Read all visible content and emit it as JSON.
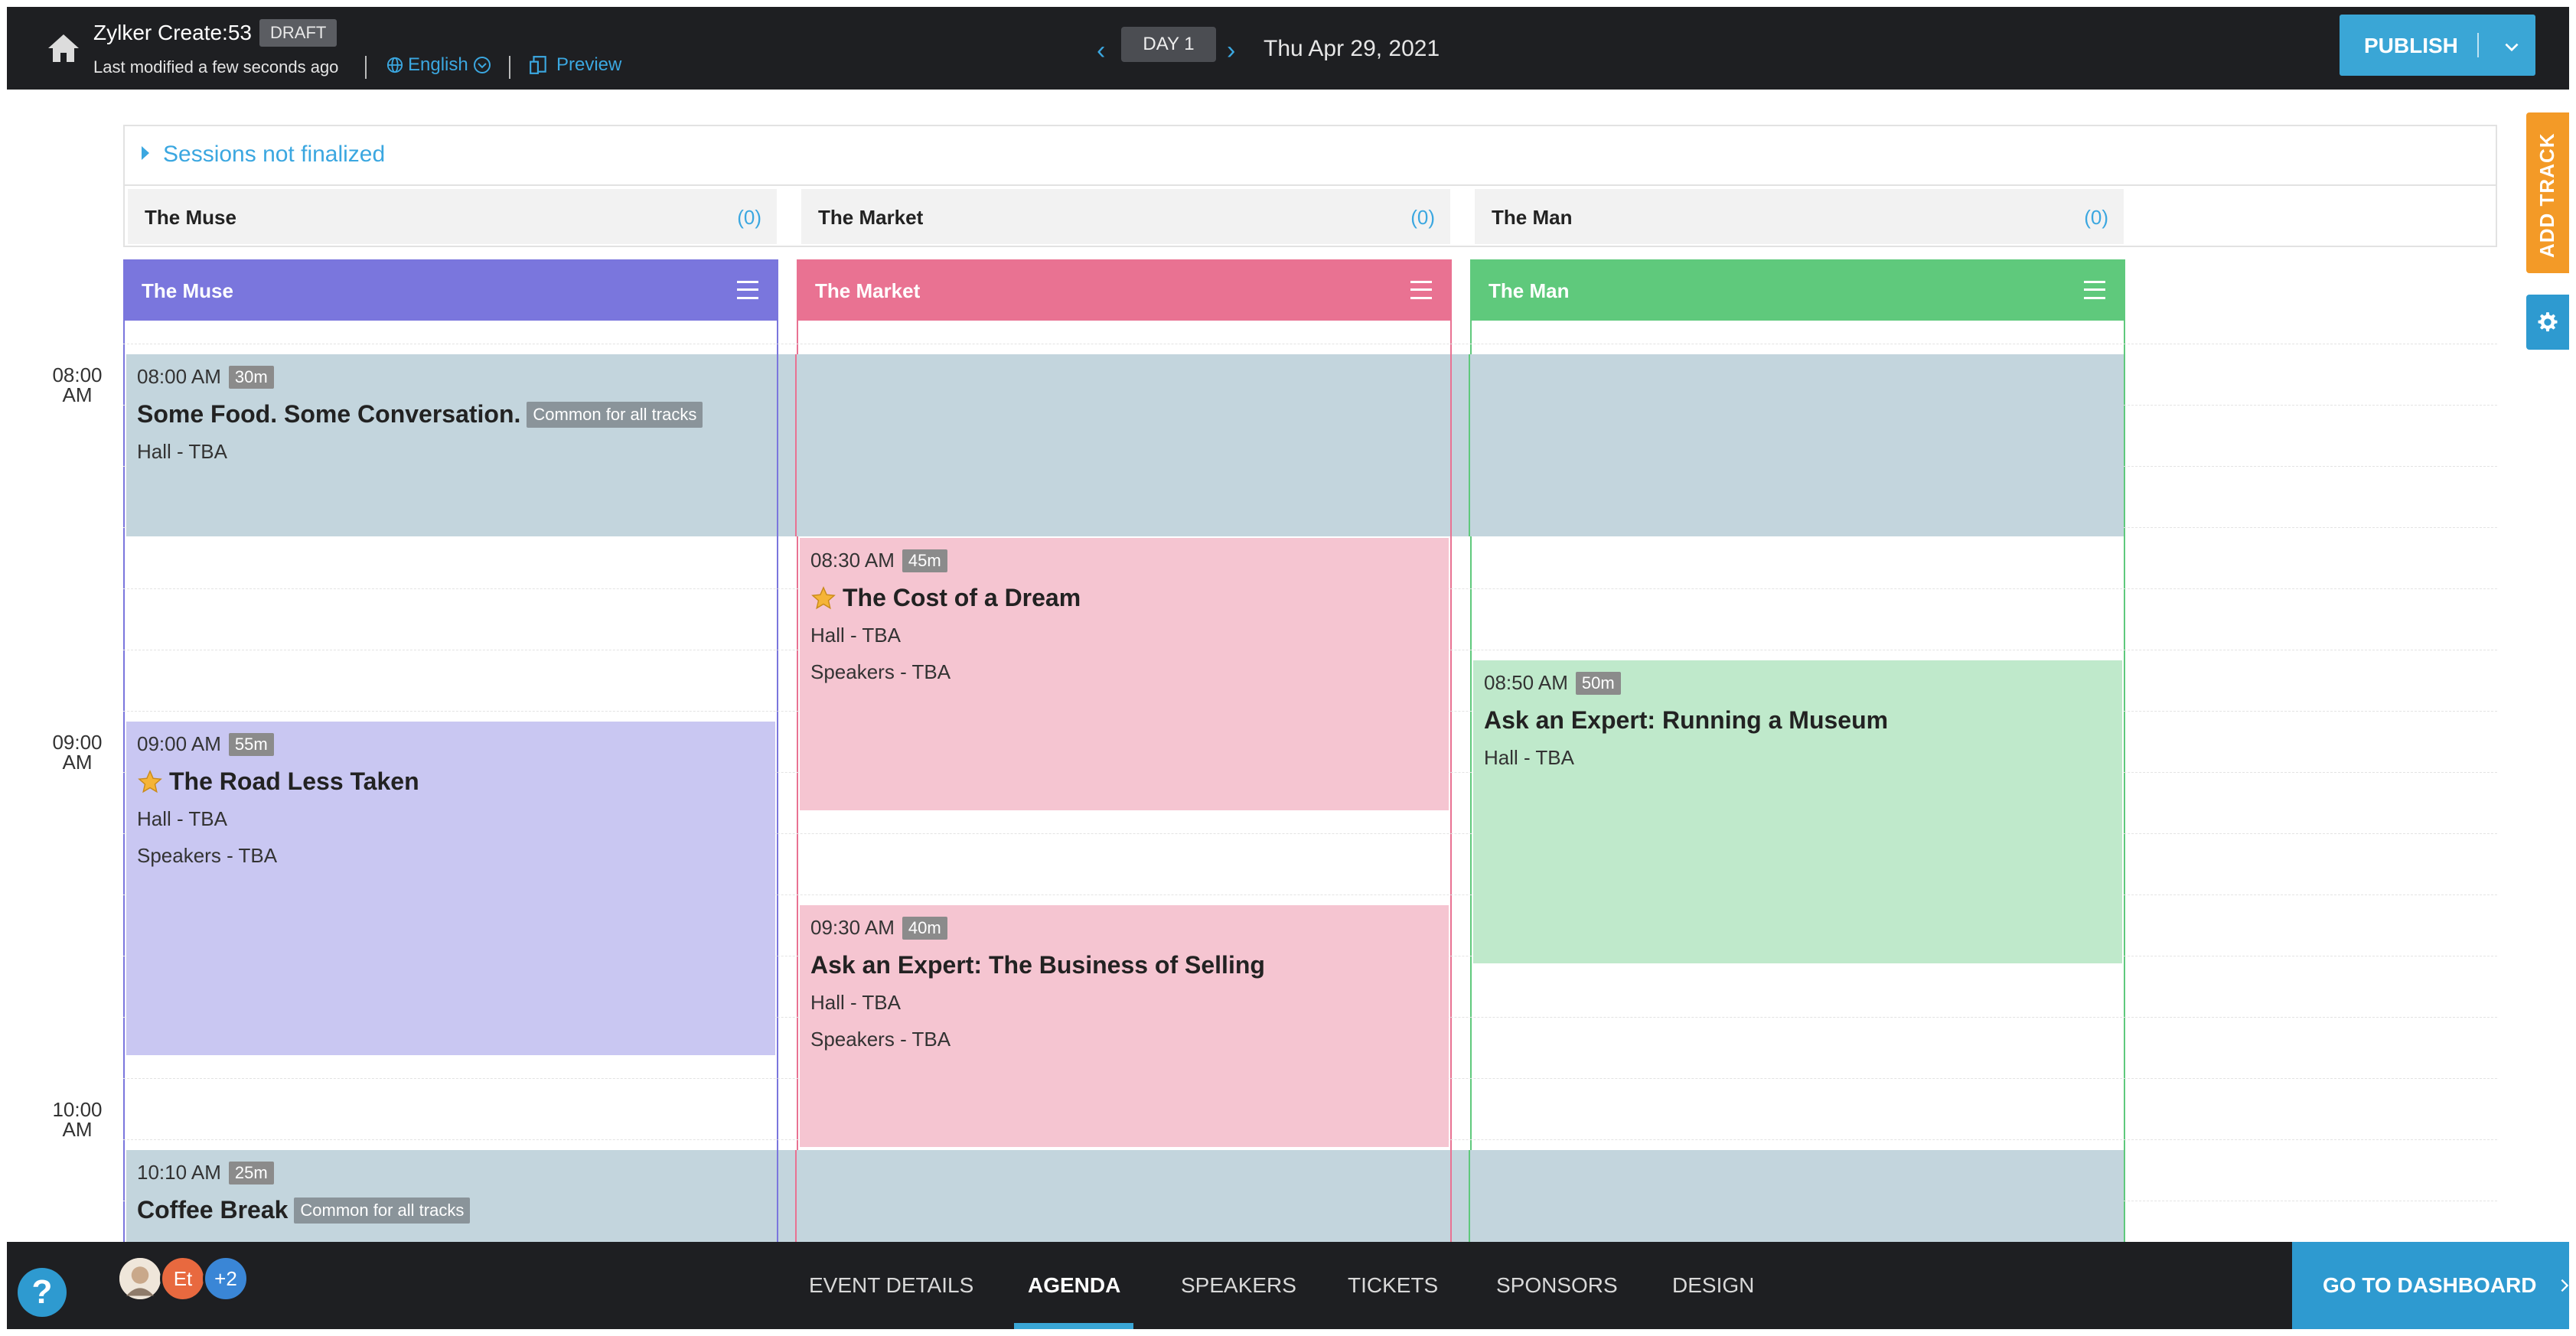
{
  "header": {
    "app_title": "Zylker Create:53",
    "status_badge": "DRAFT",
    "modified_text": "Last modified a few seconds ago",
    "language": "English",
    "preview_label": "Preview",
    "day_label": "DAY 1",
    "date": "Thu Apr 29, 2021",
    "publish_label": "PUBLISH"
  },
  "unfinalized": {
    "label": "Sessions not finalized",
    "tracks": [
      {
        "name": "The Muse",
        "count": "(0)"
      },
      {
        "name": "The Market",
        "count": "(0)"
      },
      {
        "name": "The Man",
        "count": "(0)"
      }
    ]
  },
  "side": {
    "add_track_label": "ADD TRACK"
  },
  "times": [
    {
      "hour": "08:00",
      "period": "AM"
    },
    {
      "hour": "09:00",
      "period": "AM"
    },
    {
      "hour": "10:00",
      "period": "AM"
    }
  ],
  "tracks": [
    {
      "name": "The Muse",
      "color": "#7a76dd"
    },
    {
      "name": "The Market",
      "color": "#e97292"
    },
    {
      "name": "The Man",
      "color": "#5fc97c"
    }
  ],
  "sessions": {
    "food": {
      "time": "08:00 AM",
      "duration": "30m",
      "title": "Some Food. Some Conversation.",
      "tag": "Common for all tracks",
      "hall": "Hall - TBA"
    },
    "dream": {
      "time": "08:30 AM",
      "duration": "45m",
      "title": "The Cost of a Dream",
      "hall": "Hall - TBA",
      "speakers": "Speakers - TBA"
    },
    "museum": {
      "time": "08:50 AM",
      "duration": "50m",
      "title": "Ask an Expert: Running a Museum",
      "hall": "Hall - TBA"
    },
    "road": {
      "time": "09:00 AM",
      "duration": "55m",
      "title": "The Road Less Taken",
      "hall": "Hall - TBA",
      "speakers": "Speakers - TBA"
    },
    "selling": {
      "time": "09:30 AM",
      "duration": "40m",
      "title": "Ask an Expert: The Business of Selling",
      "hall": "Hall - TBA",
      "speakers": "Speakers - TBA"
    },
    "coffee": {
      "time": "10:10 AM",
      "duration": "25m",
      "title": "Coffee Break",
      "tag": "Common for all tracks"
    }
  },
  "footer": {
    "help": "?",
    "avatars": [
      "Et",
      "+2"
    ],
    "nav": [
      "EVENT DETAILS",
      "AGENDA",
      "SPEAKERS",
      "TICKETS",
      "SPONSORS",
      "DESIGN"
    ],
    "active_tab": "AGENDA",
    "dashboard_label": "GO TO DASHBOARD"
  },
  "colors": {
    "accent": "#3aa6d6",
    "common_session": "#c3d5dd",
    "muse_session": "#c9c7f2",
    "market_session": "#f5c5d1",
    "man_session": "#bfe9cb",
    "add_track": "#f39a27"
  },
  "icons": [
    "home-icon",
    "globe-icon",
    "chevron-down-circle-icon",
    "preview-icon",
    "chevron-left-icon",
    "chevron-right-icon",
    "chevron-down-icon",
    "gear-icon",
    "menu-icon",
    "star-icon",
    "question-icon"
  ]
}
